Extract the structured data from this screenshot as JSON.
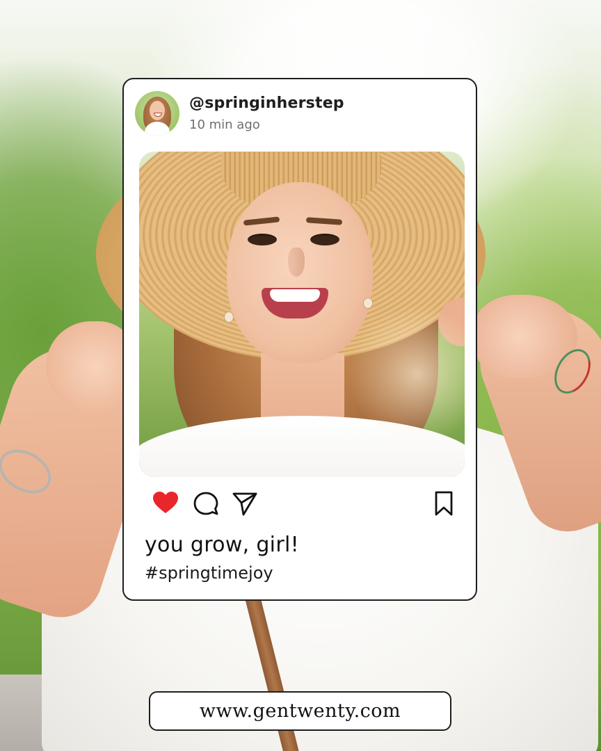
{
  "post": {
    "username": "@springinherstep",
    "timestamp": "10 min ago",
    "caption": "you grow, girl!",
    "hashtag": "#springtimejoy",
    "liked": true
  },
  "actions": {
    "icons": [
      "heart-icon",
      "comment-icon",
      "send-icon",
      "bookmark-icon"
    ]
  },
  "footer": {
    "url": "www.gentwenty.com"
  },
  "colors": {
    "like": "#e8262b",
    "card_border": "#1e1e1e",
    "text": "#111111",
    "muted": "#6e6e6e"
  }
}
